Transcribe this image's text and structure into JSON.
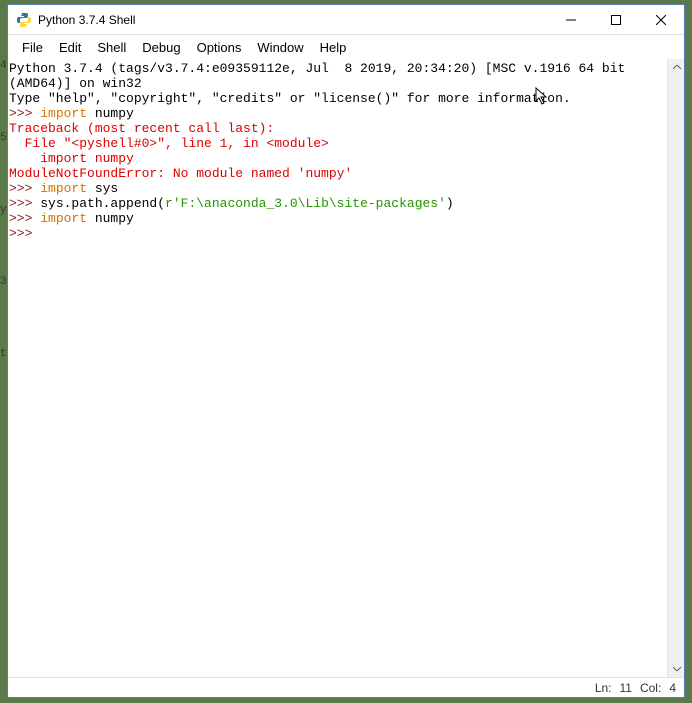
{
  "window": {
    "title": "Python 3.7.4 Shell"
  },
  "menu": {
    "file": "File",
    "edit": "Edit",
    "shell": "Shell",
    "debug": "Debug",
    "options": "Options",
    "window": "Window",
    "help": "Help"
  },
  "shell": {
    "banner1": "Python 3.7.4 (tags/v3.7.4:e09359112e, Jul  8 2019, 20:34:20) [MSC v.1916 64 bit",
    "banner2": "(AMD64)] on win32",
    "banner3": "Type \"help\", \"copyright\", \"credits\" or \"license()\" for more information.",
    "prompt": ">>> ",
    "import_kw": "import",
    "numpy": " numpy",
    "tb1": "Traceback (most recent call last):",
    "tb2": "  File \"<pyshell#0>\", line 1, in <module>",
    "tb3": "    import numpy",
    "tb4": "ModuleNotFoundError: No module named 'numpy'",
    "sys": " sys",
    "append_pre": "sys.path.append(",
    "append_str": "r'F:\\anaconda_3.0\\Lib\\site-packages'",
    "append_post": ")"
  },
  "status": {
    "ln_label": "Ln:",
    "ln_val": "11",
    "col_label": "Col:",
    "col_val": "4"
  },
  "edge": {
    "a": "4",
    "b": "5",
    "c": "y",
    "d": "3",
    "e": "t"
  }
}
